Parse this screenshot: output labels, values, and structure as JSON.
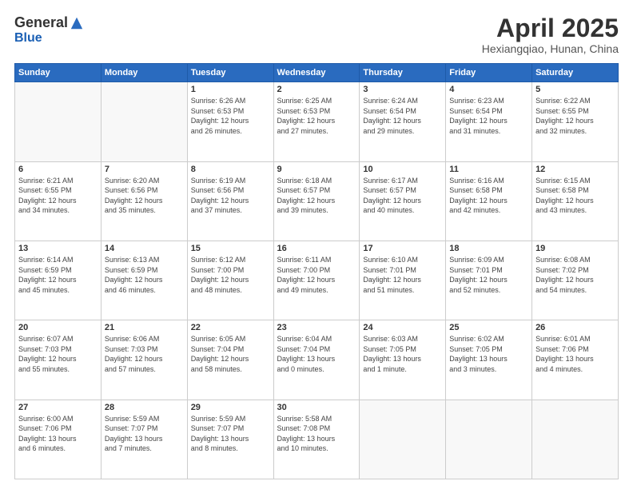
{
  "logo": {
    "general": "General",
    "blue": "Blue"
  },
  "title": "April 2025",
  "location": "Hexiangqiao, Hunan, China",
  "days_header": [
    "Sunday",
    "Monday",
    "Tuesday",
    "Wednesday",
    "Thursday",
    "Friday",
    "Saturday"
  ],
  "weeks": [
    [
      {
        "day": "",
        "info": ""
      },
      {
        "day": "",
        "info": ""
      },
      {
        "day": "1",
        "info": "Sunrise: 6:26 AM\nSunset: 6:53 PM\nDaylight: 12 hours\nand 26 minutes."
      },
      {
        "day": "2",
        "info": "Sunrise: 6:25 AM\nSunset: 6:53 PM\nDaylight: 12 hours\nand 27 minutes."
      },
      {
        "day": "3",
        "info": "Sunrise: 6:24 AM\nSunset: 6:54 PM\nDaylight: 12 hours\nand 29 minutes."
      },
      {
        "day": "4",
        "info": "Sunrise: 6:23 AM\nSunset: 6:54 PM\nDaylight: 12 hours\nand 31 minutes."
      },
      {
        "day": "5",
        "info": "Sunrise: 6:22 AM\nSunset: 6:55 PM\nDaylight: 12 hours\nand 32 minutes."
      }
    ],
    [
      {
        "day": "6",
        "info": "Sunrise: 6:21 AM\nSunset: 6:55 PM\nDaylight: 12 hours\nand 34 minutes."
      },
      {
        "day": "7",
        "info": "Sunrise: 6:20 AM\nSunset: 6:56 PM\nDaylight: 12 hours\nand 35 minutes."
      },
      {
        "day": "8",
        "info": "Sunrise: 6:19 AM\nSunset: 6:56 PM\nDaylight: 12 hours\nand 37 minutes."
      },
      {
        "day": "9",
        "info": "Sunrise: 6:18 AM\nSunset: 6:57 PM\nDaylight: 12 hours\nand 39 minutes."
      },
      {
        "day": "10",
        "info": "Sunrise: 6:17 AM\nSunset: 6:57 PM\nDaylight: 12 hours\nand 40 minutes."
      },
      {
        "day": "11",
        "info": "Sunrise: 6:16 AM\nSunset: 6:58 PM\nDaylight: 12 hours\nand 42 minutes."
      },
      {
        "day": "12",
        "info": "Sunrise: 6:15 AM\nSunset: 6:58 PM\nDaylight: 12 hours\nand 43 minutes."
      }
    ],
    [
      {
        "day": "13",
        "info": "Sunrise: 6:14 AM\nSunset: 6:59 PM\nDaylight: 12 hours\nand 45 minutes."
      },
      {
        "day": "14",
        "info": "Sunrise: 6:13 AM\nSunset: 6:59 PM\nDaylight: 12 hours\nand 46 minutes."
      },
      {
        "day": "15",
        "info": "Sunrise: 6:12 AM\nSunset: 7:00 PM\nDaylight: 12 hours\nand 48 minutes."
      },
      {
        "day": "16",
        "info": "Sunrise: 6:11 AM\nSunset: 7:00 PM\nDaylight: 12 hours\nand 49 minutes."
      },
      {
        "day": "17",
        "info": "Sunrise: 6:10 AM\nSunset: 7:01 PM\nDaylight: 12 hours\nand 51 minutes."
      },
      {
        "day": "18",
        "info": "Sunrise: 6:09 AM\nSunset: 7:01 PM\nDaylight: 12 hours\nand 52 minutes."
      },
      {
        "day": "19",
        "info": "Sunrise: 6:08 AM\nSunset: 7:02 PM\nDaylight: 12 hours\nand 54 minutes."
      }
    ],
    [
      {
        "day": "20",
        "info": "Sunrise: 6:07 AM\nSunset: 7:03 PM\nDaylight: 12 hours\nand 55 minutes."
      },
      {
        "day": "21",
        "info": "Sunrise: 6:06 AM\nSunset: 7:03 PM\nDaylight: 12 hours\nand 57 minutes."
      },
      {
        "day": "22",
        "info": "Sunrise: 6:05 AM\nSunset: 7:04 PM\nDaylight: 12 hours\nand 58 minutes."
      },
      {
        "day": "23",
        "info": "Sunrise: 6:04 AM\nSunset: 7:04 PM\nDaylight: 13 hours\nand 0 minutes."
      },
      {
        "day": "24",
        "info": "Sunrise: 6:03 AM\nSunset: 7:05 PM\nDaylight: 13 hours\nand 1 minute."
      },
      {
        "day": "25",
        "info": "Sunrise: 6:02 AM\nSunset: 7:05 PM\nDaylight: 13 hours\nand 3 minutes."
      },
      {
        "day": "26",
        "info": "Sunrise: 6:01 AM\nSunset: 7:06 PM\nDaylight: 13 hours\nand 4 minutes."
      }
    ],
    [
      {
        "day": "27",
        "info": "Sunrise: 6:00 AM\nSunset: 7:06 PM\nDaylight: 13 hours\nand 6 minutes."
      },
      {
        "day": "28",
        "info": "Sunrise: 5:59 AM\nSunset: 7:07 PM\nDaylight: 13 hours\nand 7 minutes."
      },
      {
        "day": "29",
        "info": "Sunrise: 5:59 AM\nSunset: 7:07 PM\nDaylight: 13 hours\nand 8 minutes."
      },
      {
        "day": "30",
        "info": "Sunrise: 5:58 AM\nSunset: 7:08 PM\nDaylight: 13 hours\nand 10 minutes."
      },
      {
        "day": "",
        "info": ""
      },
      {
        "day": "",
        "info": ""
      },
      {
        "day": "",
        "info": ""
      }
    ]
  ]
}
